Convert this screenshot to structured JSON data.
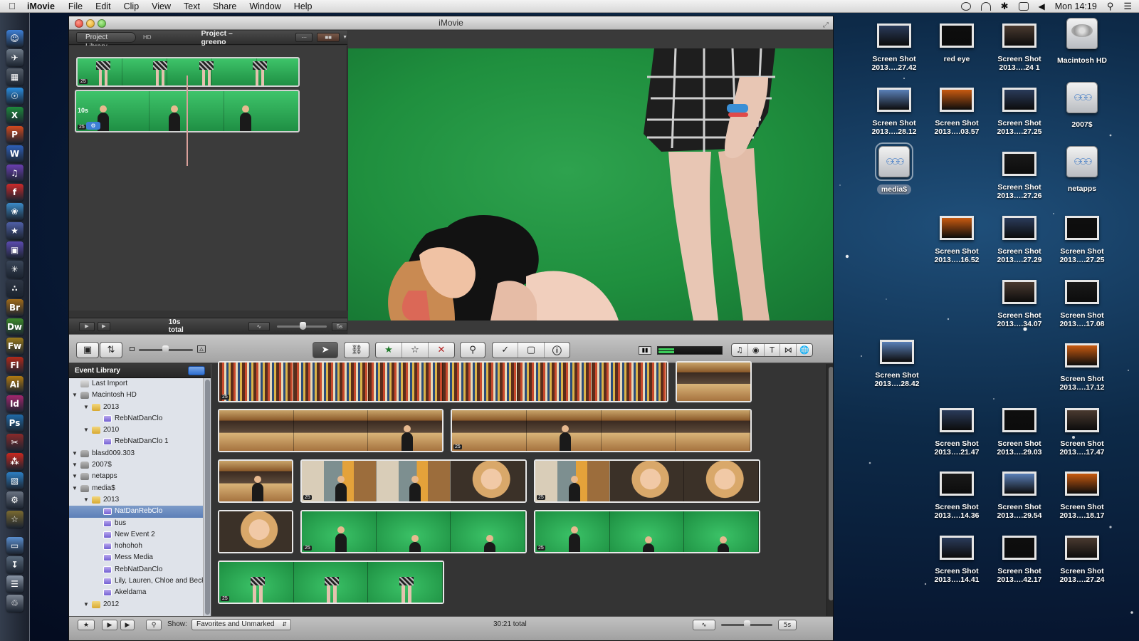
{
  "menubar": {
    "app_name": "iMovie",
    "menus": [
      "File",
      "Edit",
      "Clip",
      "View",
      "Text",
      "Share",
      "Window",
      "Help"
    ],
    "clock": "Mon 14:19"
  },
  "window": {
    "title": "iMovie"
  },
  "project": {
    "library_button": "Project Library",
    "hd_badge": "HD",
    "title": "Project – greeno",
    "duration_overlay": "10s",
    "badge": "25",
    "total": "10s total",
    "zoom_label": "5s"
  },
  "event_library": {
    "header": "Event Library",
    "items": [
      {
        "label": "Last Import",
        "type": "import",
        "level": 0,
        "disclosure": ""
      },
      {
        "label": "Macintosh HD",
        "type": "hd",
        "level": 0,
        "disclosure": "▼"
      },
      {
        "label": "2013",
        "type": "folder",
        "level": 1,
        "disclosure": "▼"
      },
      {
        "label": "RebNatDanClo",
        "type": "event",
        "level": 2,
        "disclosure": ""
      },
      {
        "label": "2010",
        "type": "folder",
        "level": 1,
        "disclosure": "▼"
      },
      {
        "label": "RebNatDanClo 1",
        "type": "event",
        "level": 2,
        "disclosure": ""
      },
      {
        "label": "blasd009.303",
        "type": "hd",
        "level": 0,
        "disclosure": "▼"
      },
      {
        "label": "2007$",
        "type": "hd",
        "level": 0,
        "disclosure": "▼"
      },
      {
        "label": "netapps",
        "type": "hd",
        "level": 0,
        "disclosure": "▼"
      },
      {
        "label": "media$",
        "type": "hd",
        "level": 0,
        "disclosure": "▼"
      },
      {
        "label": "2013",
        "type": "folder",
        "level": 1,
        "disclosure": "▼"
      },
      {
        "label": "NatDanRebClo",
        "type": "event",
        "level": 2,
        "disclosure": "",
        "selected": true
      },
      {
        "label": "bus",
        "type": "event",
        "level": 2,
        "disclosure": ""
      },
      {
        "label": "New Event 2",
        "type": "event",
        "level": 2,
        "disclosure": ""
      },
      {
        "label": "hohohoh",
        "type": "event",
        "level": 2,
        "disclosure": ""
      },
      {
        "label": "Mess Media",
        "type": "event",
        "level": 2,
        "disclosure": ""
      },
      {
        "label": "RebNatDanClo",
        "type": "event",
        "level": 2,
        "disclosure": ""
      },
      {
        "label": "Lily, Lauren, Chloe and Becky",
        "type": "event",
        "level": 2,
        "disclosure": ""
      },
      {
        "label": "Akeldama",
        "type": "event",
        "level": 2,
        "disclosure": ""
      },
      {
        "label": "2012",
        "type": "folder",
        "level": 1,
        "disclosure": "▼"
      }
    ]
  },
  "event_browser": {
    "clip_badge": "25",
    "show_label": "Show:",
    "show_value": "Favorites and Unmarked",
    "total": "30:21 total",
    "zoom_label": "5s"
  },
  "desktop_icons": [
    {
      "line1": "Screen Shot",
      "line2": "2013….27.42",
      "kind": "thumb"
    },
    {
      "line1": "red eye",
      "line2": "",
      "kind": "thumb"
    },
    {
      "line1": "Screen Shot",
      "line2": "2013….24 1",
      "kind": "thumb"
    },
    {
      "line1": "Macintosh HD",
      "line2": "",
      "kind": "hd"
    },
    {
      "line1": "Screen Shot",
      "line2": "2013….28.12",
      "kind": "thumb"
    },
    {
      "line1": "Screen Shot",
      "line2": "2013….03.57",
      "kind": "thumb"
    },
    {
      "line1": "Screen Shot",
      "line2": "2013….27.25",
      "kind": "thumb"
    },
    {
      "line1": "2007$",
      "line2": "",
      "kind": "net"
    },
    {
      "line1": "media$",
      "line2": "",
      "kind": "net",
      "selected": true
    },
    {
      "line1": "Screen Shot",
      "line2": "2013….27.26",
      "kind": "thumb"
    },
    {
      "line1": "netapps",
      "line2": "",
      "kind": "net"
    },
    {
      "line1": "Screen Shot",
      "line2": "2013….16.52",
      "kind": "thumb"
    },
    {
      "line1": "Screen Shot",
      "line2": "2013….27.29",
      "kind": "thumb"
    },
    {
      "line1": "Screen Shot",
      "line2": "2013….27.25",
      "kind": "thumb"
    },
    {
      "line1": "Screen Shot",
      "line2": "2013….34.07",
      "kind": "thumb"
    },
    {
      "line1": "Screen Shot",
      "line2": "2013….17.08",
      "kind": "thumb"
    },
    {
      "line1": "Screen Shot",
      "line2": "2013….28.42",
      "kind": "thumb"
    },
    {
      "line1": "Screen Shot",
      "line2": "2013….17.12",
      "kind": "thumb"
    },
    {
      "line1": "Screen Shot",
      "line2": "2013….21.47",
      "kind": "thumb"
    },
    {
      "line1": "Screen Shot",
      "line2": "2013….29.03",
      "kind": "thumb"
    },
    {
      "line1": "Screen Shot",
      "line2": "2013….17.47",
      "kind": "thumb"
    },
    {
      "line1": "Screen Shot",
      "line2": "2013….14.36",
      "kind": "thumb"
    },
    {
      "line1": "Screen Shot",
      "line2": "2013….29.54",
      "kind": "thumb"
    },
    {
      "line1": "Screen Shot",
      "line2": "2013….18.17",
      "kind": "thumb"
    },
    {
      "line1": "Screen Shot",
      "line2": "2013….14.41",
      "kind": "thumb"
    },
    {
      "line1": "Screen Shot",
      "line2": "2013….42.17",
      "kind": "thumb"
    },
    {
      "line1": "Screen Shot",
      "line2": "2013….27.24",
      "kind": "thumb"
    }
  ],
  "dock_apps": [
    {
      "icon": "finder-icon",
      "glyph": "☺",
      "color": "#3d7fd6"
    },
    {
      "icon": "launchpad-icon",
      "glyph": "✈",
      "color": "#6e7a88"
    },
    {
      "icon": "mission-control-icon",
      "glyph": "▦",
      "color": "#555e6a"
    },
    {
      "icon": "safari-icon",
      "glyph": "☉",
      "color": "#2a8ee0"
    },
    {
      "icon": "excel-icon",
      "glyph": "X",
      "color": "#1e8a3c"
    },
    {
      "icon": "powerpoint-icon",
      "glyph": "P",
      "color": "#d24a1f"
    },
    {
      "icon": "word-icon",
      "glyph": "W",
      "color": "#2e5fb8"
    },
    {
      "icon": "itunes-icon",
      "glyph": "♫",
      "color": "#6a3fb0"
    },
    {
      "icon": "flash-icon",
      "glyph": "f",
      "color": "#cc2a2a"
    },
    {
      "icon": "iphoto-icon",
      "glyph": "❀",
      "color": "#3b8bc7"
    },
    {
      "icon": "imovie-icon",
      "glyph": "★",
      "color": "#4f5fa8"
    },
    {
      "icon": "screenshot-icon",
      "glyph": "▣",
      "color": "#5b4ab0"
    },
    {
      "icon": "network-icon",
      "glyph": "✳",
      "color": "#3a4658"
    },
    {
      "icon": "dots-icon",
      "glyph": "∴",
      "color": "#2e3644"
    },
    {
      "icon": "bridge-icon",
      "glyph": "Br",
      "color": "#a06a1a"
    },
    {
      "icon": "dreamweaver-icon",
      "glyph": "Dw",
      "color": "#3d8a2b"
    },
    {
      "icon": "fireworks-icon",
      "glyph": "Fw",
      "color": "#9a7a1a"
    },
    {
      "icon": "flash-pro-icon",
      "glyph": "Fl",
      "color": "#b22a1a"
    },
    {
      "icon": "illustrator-icon",
      "glyph": "Ai",
      "color": "#b07a12"
    },
    {
      "icon": "indesign-icon",
      "glyph": "Id",
      "color": "#a3266e"
    },
    {
      "icon": "photoshop-icon",
      "glyph": "Ps",
      "color": "#1f6aa8"
    },
    {
      "icon": "pdf-tools-icon",
      "glyph": "✂",
      "color": "#8a2a2a"
    },
    {
      "icon": "acrobat-icon",
      "glyph": "⁂",
      "color": "#c8281f"
    },
    {
      "icon": "preview-icon",
      "glyph": "▧",
      "color": "#2c7fc4"
    },
    {
      "icon": "disk-utility-icon",
      "glyph": "⚙",
      "color": "#6a7382"
    },
    {
      "icon": "stickies-icon",
      "glyph": "☆",
      "color": "#7b6a30"
    },
    {
      "icon": "folder-icon",
      "glyph": "▭",
      "color": "#5b8fcf"
    },
    {
      "icon": "downloads-icon",
      "glyph": "↧",
      "color": "#5a6a7c"
    },
    {
      "icon": "documents-icon",
      "glyph": "☰",
      "color": "#8a96a6"
    },
    {
      "icon": "trash-icon",
      "glyph": "♲",
      "color": "#7c8592"
    }
  ]
}
